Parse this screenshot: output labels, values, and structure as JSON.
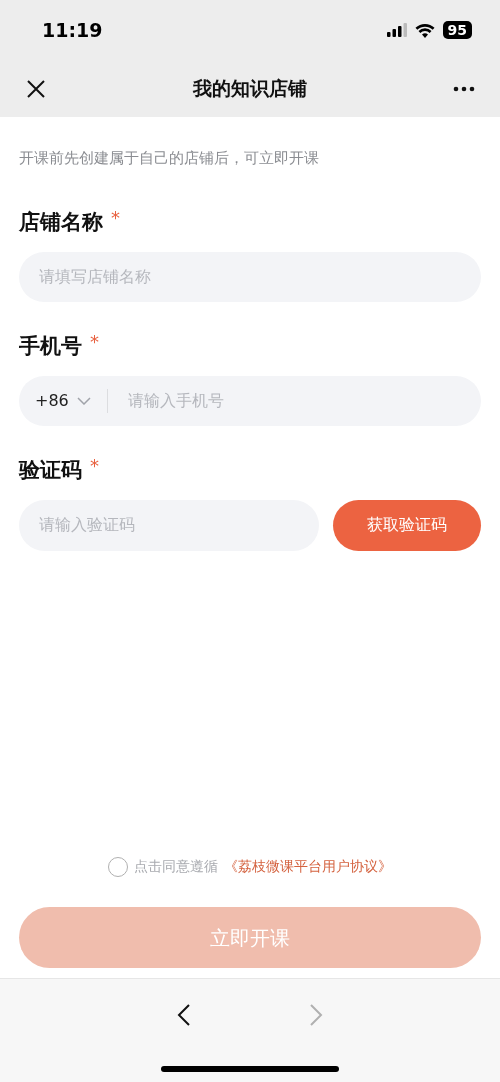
{
  "status_bar": {
    "time": "11:19",
    "battery": "95"
  },
  "nav": {
    "title": "我的知识店铺"
  },
  "hint": "开课前先创建属于自己的店铺后，可立即开课",
  "fields": [
    {
      "kind": "text",
      "label": "店铺名称",
      "required": true,
      "required_mark": "*",
      "placeholder": "请填写店铺名称"
    },
    {
      "kind": "phone",
      "label": "手机号",
      "required": true,
      "required_mark": "*",
      "prefix": "+86",
      "placeholder": "请输入手机号"
    },
    {
      "kind": "code",
      "label": "验证码",
      "required": true,
      "required_mark": "*",
      "placeholder": "请输入验证码",
      "button": "获取验证码"
    }
  ],
  "agreement": {
    "checked": false,
    "text": "点击同意遵循",
    "link": "《荔枝微课平台用户协议》"
  },
  "submit": {
    "label": "立即开课",
    "disabled": true
  },
  "browser_nav": {
    "back_disabled": false,
    "forward_disabled": true
  }
}
